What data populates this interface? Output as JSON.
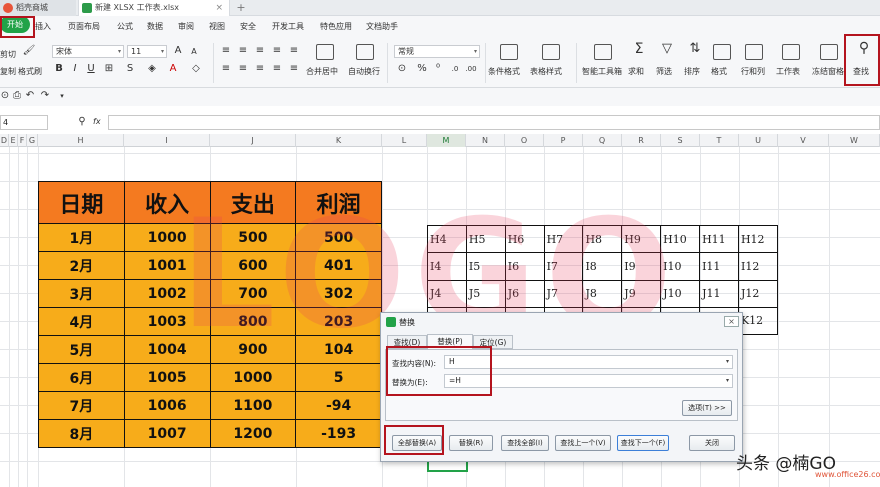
{
  "tabs": {
    "home": "稻壳商城",
    "doc": "新建 XLSX 工作表.xlsx",
    "add": "+",
    "close": "×"
  },
  "menu": [
    "开始",
    "插入",
    "页面布局",
    "公式",
    "数据",
    "审阅",
    "视图",
    "安全",
    "开发工具",
    "特色应用",
    "文档助手"
  ],
  "ribbon": {
    "clip_top": "剪切",
    "clip_bottom": "复制",
    "format_painter": "格式刷",
    "font_name": "宋体",
    "font_size": "11",
    "number_format": "常规",
    "bold": "B",
    "italic": "I",
    "underline": "U",
    "merge_center": "合并居中",
    "wrap": "自动换行",
    "cond_format": "条件格式",
    "table_style": "表格样式",
    "smart_toolbox": "智能工具箱",
    "sum": "求和",
    "filter": "筛选",
    "sort": "排序",
    "format": "格式",
    "rowcol": "行和列",
    "sheet": "工作表",
    "freeze": "冻结窗格",
    "find": "查找"
  },
  "formula_bar": {
    "name_box": "4",
    "fx": "fx"
  },
  "columns": [
    "D",
    "E",
    "F",
    "G",
    "H",
    "I",
    "J",
    "K",
    "L",
    "M",
    "N",
    "O",
    "P",
    "Q",
    "R",
    "S",
    "T",
    "U",
    "V",
    "W"
  ],
  "data_table": {
    "headers": [
      "日期",
      "收入",
      "支出",
      "利润"
    ],
    "rows": [
      [
        "1月",
        "1000",
        "500",
        "500"
      ],
      [
        "2月",
        "1001",
        "600",
        "401"
      ],
      [
        "3月",
        "1002",
        "700",
        "302"
      ],
      [
        "4月",
        "1003",
        "800",
        "203"
      ],
      [
        "5月",
        "1004",
        "900",
        "104"
      ],
      [
        "6月",
        "1005",
        "1000",
        "5"
      ],
      [
        "7月",
        "1006",
        "1100",
        "-94"
      ],
      [
        "8月",
        "1007",
        "1200",
        "-193"
      ]
    ]
  },
  "h_grid": [
    [
      "H4",
      "H5",
      "H6",
      "H7",
      "H8",
      "H9",
      "H10",
      "H11",
      "H12"
    ],
    [
      "I4",
      "I5",
      "I6",
      "I7",
      "I8",
      "I9",
      "I10",
      "I11",
      "I12"
    ],
    [
      "J4",
      "J5",
      "J6",
      "J7",
      "J8",
      "J9",
      "J10",
      "J11",
      "J12"
    ],
    [
      "",
      "",
      "",
      "",
      "",
      "",
      "",
      "",
      "K12"
    ]
  ],
  "watermark": "LOGO",
  "dialog": {
    "title": "替换",
    "close": "×",
    "tabs": [
      "查找(D)",
      "替换(P)",
      "定位(G)"
    ],
    "find_label": "查找内容(N):",
    "find_value": "H",
    "replace_label": "替换为(E):",
    "replace_value": "=H",
    "options_btn": "选项(T) >>",
    "buttons": [
      "全部替换(A)",
      "替换(R)",
      "查找全部(I)",
      "查找上一个(V)",
      "查找下一个(F)",
      "关闭"
    ]
  },
  "credit": {
    "main": "头条 @楠GO",
    "site": "www.office26.com"
  },
  "colors": {
    "accent_green": "#22a248",
    "header_orange": "#f47a20",
    "row_orange": "#f7ac1a",
    "highlight_red": "#b4141e"
  }
}
